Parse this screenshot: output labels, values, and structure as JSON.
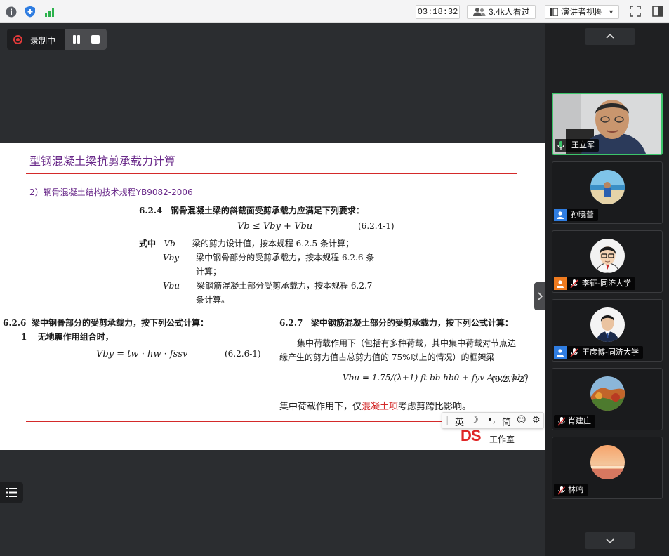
{
  "topbar": {
    "timer": "03:18:32",
    "viewers": "3.4k人看过",
    "presenter_view": "演讲者视图"
  },
  "recording": {
    "label": "录制中"
  },
  "slide": {
    "title": "型钢混凝土梁抗剪承载力计算",
    "subtitle": "2）钢骨混凝土结构技术规程YB9082-2006",
    "clause_624_no": "6.2.4",
    "clause_624_text": "钢骨混凝土梁的斜截面受剪承载力应满足下列要求：",
    "eq_624": "Vb ≤ Vby + Vbu",
    "eq_624_no": "(6.2.4-1)",
    "where_label": "式中",
    "def1_sym": "Vb",
    "def1_text": "——梁的剪力设计值，按本规程 6.2.5 条计算；",
    "def2_sym": "Vby",
    "def2_text_a": "——梁中钢骨部分的受剪承载力，按本规程 6.2.6 条",
    "def2_text_b": "计算；",
    "def3_sym": "Vbu",
    "def3_text_a": "——梁钢筋混凝土部分受剪承载力，按本规程 6.2.7",
    "def3_text_b": "条计算。",
    "clause_626_no": "6.2.6",
    "clause_626_text": "梁中钢骨部分的受剪承载力，按下列公式计算：",
    "item1_no": "1",
    "item1_text": "无地震作用组合时，",
    "eq_626": "Vby = tw · hw · fssv",
    "eq_626_no": "(6.2.6-1)",
    "clause_627_no": "6.2.7",
    "clause_627_text": "梁中钢筋混凝土部分的受剪承载力，按下列公式计算：",
    "clause_627_body_a": "集中荷载作用下（包括有多种荷载，其中集中荷载对节点边",
    "clause_627_body_b": "缘产生的剪力值占总剪力值的 75%以上的情况）的框架梁",
    "eq_627": "Vbu = 1.75/(λ+1) ft bb hb0 + fyv Asv/s hb0",
    "eq_627_no": "(6.2.7-2)",
    "note_a": "集中荷载作用下，仅",
    "note_hl": "混凝土项",
    "note_b": "考虑剪跨比影响。",
    "logo": "DS",
    "studio": "工作室"
  },
  "ime": {
    "lang": "英",
    "punct": "•,",
    "simplified": "简"
  },
  "participants": [
    {
      "name": "王立军",
      "mic": "on",
      "badge": "none"
    },
    {
      "name": "孙晓蕾",
      "mic": "none",
      "badge": "blue"
    },
    {
      "name": "李征-同济大学",
      "mic": "off",
      "badge": "orange"
    },
    {
      "name": "王彦博-同济大学",
      "mic": "off",
      "badge": "blue"
    },
    {
      "name": "肖建庄",
      "mic": "off",
      "badge": "none"
    },
    {
      "name": "林鸣",
      "mic": "off",
      "badge": "none"
    }
  ],
  "colors": {
    "accent_green": "#3cc46a",
    "title_purple": "#6a2a8a",
    "rule_red": "#d42a2a",
    "rec_red": "#e23a3a"
  }
}
